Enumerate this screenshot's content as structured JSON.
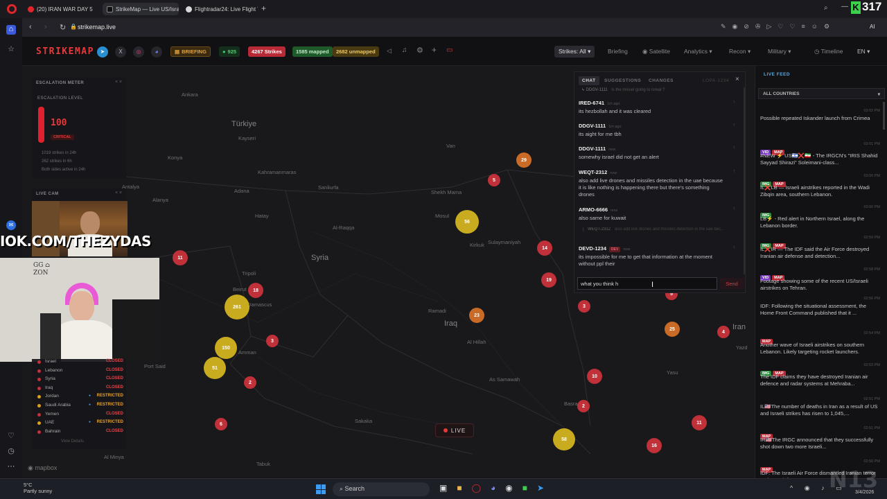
{
  "browser": {
    "tabs": [
      {
        "title": "(20) IRAN WAR DAY 5",
        "icon": "youtube-icon"
      },
      {
        "title": "StrikeMap — Live US/Isra",
        "icon": "strikemap-icon"
      },
      {
        "title": "Flightradar24: Live Flight T",
        "icon": "flightradar-icon"
      }
    ],
    "url": "strikemap.live",
    "overlay_counter": "317"
  },
  "header": {
    "logo": "STRIKEMAP",
    "briefing_btn": "BRIEFING",
    "online": "925",
    "strikes": "4267 Strikes",
    "mapped": "1585 mapped",
    "unmapped": "2682 unmapped",
    "nav": {
      "strikes_filter": "Strikes: All",
      "briefing": "Briefing",
      "satellite": "Satellite",
      "analytics": "Analytics",
      "recon": "Recon",
      "military": "Military",
      "timeline": "Timeline",
      "lang": "EN"
    },
    "colors": {
      "accent": "#e23a3a",
      "online": "#2a9d46",
      "strikes": "#c0313a",
      "mapped": "#2c8a3e",
      "unmapped": "#b88a1a"
    }
  },
  "escalation": {
    "panel_title": "ESCALATION METER",
    "level_label": "ESCALATION LEVEL",
    "value": "100",
    "status": "CRITICAL",
    "stats": [
      "1019 strikes in 24h",
      "262 strikes in 6h",
      "Both sides active in 24h"
    ]
  },
  "livecam": {
    "title": "LIVE CAM",
    "overlay_text": "IOK.COM/THEZYDAS"
  },
  "airspace": {
    "rows": [
      {
        "name": "Israel",
        "status": "CLOSED"
      },
      {
        "name": "Lebanon",
        "status": "CLOSED"
      },
      {
        "name": "Syria",
        "status": "CLOSED"
      },
      {
        "name": "Iraq",
        "status": "CLOSED"
      },
      {
        "name": "Jordan",
        "status": "RESTRICTED"
      },
      {
        "name": "Saudi Arabia",
        "status": "RESTRICTED"
      },
      {
        "name": "Yemen",
        "status": "CLOSED"
      },
      {
        "name": "UAE",
        "status": "RESTRICTED"
      },
      {
        "name": "Bahrain",
        "status": "CLOSED"
      }
    ],
    "view_details": "View Details"
  },
  "map": {
    "countries": [
      "Türkiye",
      "Syria",
      "Iraq",
      "Iran"
    ],
    "cities": [
      "Ankara",
      "Kayseri",
      "Konya",
      "Kahramanmaras",
      "Adana",
      "Sanliurfa",
      "Antalya",
      "Alanya",
      "Hatay",
      "Al-Raqqa",
      "Mosul",
      "Kirkuk",
      "Sulaymaniyah",
      "Shekh Mama",
      "Van",
      "Tripoli",
      "Beirut",
      "Damascus",
      "Amman",
      "Port Said",
      "Ramadi",
      "Al Hillah",
      "As Samawah",
      "Basra",
      "Sakaka",
      "Tabuk",
      "Al Minya",
      "Yazd",
      "Yasu"
    ],
    "clusters": [
      "29",
      "5",
      "56",
      "14",
      "19",
      "11",
      "18",
      "261",
      "150",
      "51",
      "3",
      "2",
      "6",
      "23",
      "3",
      "5",
      "25",
      "4",
      "10",
      "2",
      "58",
      "16",
      "11"
    ],
    "live_label": "LIVE",
    "attribution": "mapbox"
  },
  "chat": {
    "tabs": [
      "CHAT",
      "SUGGESTIONS",
      "CHANGES"
    ],
    "user_id": "LOPA-1234",
    "top_reply": {
      "user": "DDGV-1111",
      "text": "is the missel going to isreal ?"
    },
    "messages": [
      {
        "user": "IRED-6741",
        "time": "1m ago",
        "text": "its hezbollah and it was cleared"
      },
      {
        "user": "DDGV-1111",
        "time": "1m ago",
        "text": "its aight for me tbh"
      },
      {
        "user": "DDGV-1111",
        "time": "now",
        "text": "somewhy israel did not get an alert"
      },
      {
        "user": "WEQT-2312",
        "time": "now",
        "text": "also add live drones and missiles detection in the uae because it is like nothing is happening there but there's something drones"
      },
      {
        "user": "ARMO-6666",
        "time": "now",
        "text": "also same for kuwait"
      },
      {
        "user": "DEVD-1234",
        "time": "now",
        "badge": "DEV",
        "text": "its impossible for me to get that information at the moment without ppl their"
      }
    ],
    "quoted": {
      "user": "WEQT-2312",
      "text": "also add live drones and missiles detection in the uae bec..."
    },
    "input_value": "what you think h",
    "send": "Send"
  },
  "feed": {
    "title": "LIVE FEED",
    "filter": "ALL COUNTRIES",
    "items": [
      {
        "time": "03:02 PM",
        "tags": [],
        "text": "Possible repeated Iskander launch from Crimea"
      },
      {
        "time": "03:01 PM",
        "tags": [
          "VID",
          "MAP"
        ],
        "text": "#NEW ⚡ US🇮🇱❌🇮🇷 - The IRGCN's \"IRIS Shahid Sayyad Shirazi\" Soleimani-class..."
      },
      {
        "time": "03:00 PM",
        "tags": [
          "IMG",
          "MAP"
        ],
        "text": "IL❌LB — Israeli airstrikes reported in the Wadi Zibqin area, southern Lebanon."
      },
      {
        "time": "03:00 PM",
        "tags": [
          "IMG"
        ],
        "text": "LB⚡ - Red alert in Northern Israel, along the Lebanon border."
      },
      {
        "time": "02:59 PM",
        "tags": [
          "IMG",
          "MAP"
        ],
        "text": "IL❌IR — The IDF said the Air Force destroyed Iranian air defense and detection..."
      },
      {
        "time": "02:58 PM",
        "tags": [
          "VID",
          "MAP"
        ],
        "text": "Footage showing some of the recent US/Israeli airstrikes on Tehran."
      },
      {
        "time": "02:56 PM",
        "tags": [],
        "text": "IDF: Following the situational assessment, the Home Front Command published that it ..."
      },
      {
        "time": "02:54 PM",
        "tags": [
          "MAP"
        ],
        "text": "Another wave of Israeli airstrikes on southern Lebanon. Likely targeting rocket launchers."
      },
      {
        "time": "02:53 PM",
        "tags": [
          "IMG",
          "MAP"
        ],
        "text": "The IDF claims they have destroyed Iranian air defence and radar systems at Mehraba..."
      },
      {
        "time": "02:51 PM",
        "tags": [],
        "text": "IL🇺🇸The number of deaths in Iran as a result of US and Israeli strikes has risen to 1,045,..."
      },
      {
        "time": "02:51 PM",
        "tags": [
          "MAP"
        ],
        "text": "IR🇺🇸The IRGC announced that they successfully shot down two more Israeli..."
      },
      {
        "time": "02:50 PM",
        "tags": [
          "MAP"
        ],
        "text": "IDF: The Israeli Air Force dismantled Iranian terror regime's defense an..."
      }
    ]
  },
  "taskbar": {
    "temp": "5°C",
    "weather": "Partly sunny",
    "search": "Search",
    "date": "3/4/2026",
    "watermark": "N13"
  }
}
